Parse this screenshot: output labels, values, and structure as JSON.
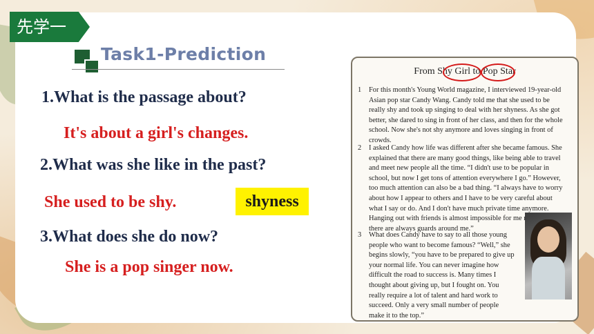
{
  "tag": {
    "label": "先学一"
  },
  "task": {
    "title": "Task1-Prediction"
  },
  "questions": [
    {
      "q": "1.What is the passage about?",
      "a": "It's about a girl's changes."
    },
    {
      "q": "2.What was she like in the past?",
      "a": "She used to be shy."
    },
    {
      "q": "3.What does she do now?",
      "a": "She is a pop singer now."
    }
  ],
  "highlight": {
    "word": "shyness"
  },
  "passage": {
    "title": "From Shy Girl to Pop Star",
    "paragraphs": [
      {
        "num": "1",
        "text": "For this month's Young World magazine, I interviewed 19-year-old Asian pop star Candy Wang. Candy told me that she used to be really shy and took up singing to deal with her shyness. As she got better, she dared to sing in front of her class, and then for the whole school. Now she's not shy anymore and loves singing in front of crowds."
      },
      {
        "num": "2",
        "text": "I asked Candy how life was different after she became famous. She explained that there are many good things, like being able to travel and meet new people all the time. “I didn't use to be popular in school, but now I get tons of attention everywhere I go.” However, too much attention can also be a bad thing. “I always have to worry about how I appear to others and I have to be very careful about what I say or do. And I don't have much private time anymore. Hanging out with friends is almost impossible for me now because there are always guards around me.”"
      },
      {
        "num": "3",
        "text": "What does Candy have to say to all those young people who want to become famous? “Well,” she begins slowly, “you have to be prepared to give up your normal life. You can never imagine how difficult the road to success is. Many times I thought about giving up, but I fought on. You really require a lot of talent and hard work to succeed. Only a very small number of people make it to the top.”"
      }
    ]
  }
}
